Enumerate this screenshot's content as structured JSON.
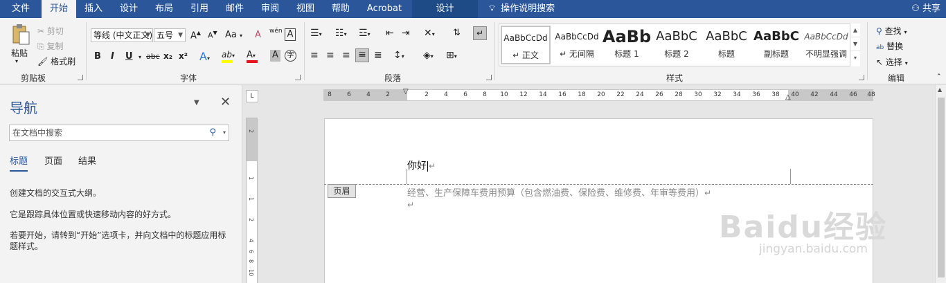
{
  "tabs": [
    "文件",
    "开始",
    "插入",
    "设计",
    "布局",
    "引用",
    "邮件",
    "审阅",
    "视图",
    "帮助",
    "Acrobat",
    "设计"
  ],
  "active_tab": "开始",
  "tell_me": "操作说明搜索",
  "share": "共享",
  "colors": {
    "brand": "#2b579a",
    "ribbon_bg": "#f3f3f3",
    "font_color_bar": "#e8141c",
    "highlight_bar": "#ffff00"
  },
  "ribbon": {
    "clipboard": {
      "paste": "粘贴",
      "cut": "剪切",
      "copy": "复制",
      "format_painter": "格式刷",
      "label": "剪贴板"
    },
    "font": {
      "font_name": "等线 (中文正文)",
      "font_size": "五号",
      "grow": "A",
      "shrink": "A",
      "case": "Aa",
      "clear": "A",
      "phonetic": "wén",
      "border_char": "A",
      "bold": "B",
      "italic": "I",
      "underline": "U",
      "strike": "abc",
      "subscript": "x₂",
      "superscript": "x²",
      "effects": "A",
      "highlight": "ab",
      "font_color": "A",
      "shading": "A",
      "enclose": "字",
      "label": "字体"
    },
    "paragraph": {
      "label": "段落"
    },
    "styles": {
      "items": [
        {
          "sample": "AaBbCcDd",
          "name": "↵ 正文"
        },
        {
          "sample": "AaBbCcDd",
          "name": "↵ 无间隔"
        },
        {
          "sample": "AaBb",
          "name": "标题 1"
        },
        {
          "sample": "AaBbC",
          "name": "标题 2"
        },
        {
          "sample": "AaBbC",
          "name": "标题"
        },
        {
          "sample": "AaBbC",
          "name": "副标题"
        },
        {
          "sample": "AaBbCcDd",
          "name": "不明显强调"
        }
      ],
      "label": "样式"
    },
    "editing": {
      "find": "查找",
      "replace": "替换",
      "select": "选择",
      "label": "编辑"
    }
  },
  "nav": {
    "title": "导航",
    "search_placeholder": "在文档中搜索",
    "tabs": [
      "标题",
      "页面",
      "结果"
    ],
    "hint1": "创建文档的交互式大纲。",
    "hint2": "它是跟踪具体位置或快速移动内容的好方式。",
    "hint3": "若要开始，请转到“开始”选项卡，并向文档中的标题应用标题样式。"
  },
  "ruler": {
    "marks": [
      "8",
      "6",
      "4",
      "2",
      "2",
      "4",
      "6",
      "8",
      "10",
      "12",
      "14",
      "16",
      "18",
      "20",
      "22",
      "24",
      "26",
      "28",
      "30",
      "32",
      "34",
      "36",
      "38",
      "40",
      "42",
      "44",
      "46",
      "48"
    ],
    "vmarks": [
      "2",
      "1",
      "1",
      "2",
      "4",
      "6",
      "8",
      "10"
    ],
    "corner": "L"
  },
  "document": {
    "body_text": "你好",
    "header_tag": "页眉",
    "header_text": "经营、生产保障车费用预算（包含燃油费、保险费、维修费、年审等费用）",
    "para_mark": "↵"
  },
  "watermark": {
    "main": "Baidu经验",
    "sub": "jingyan.baidu.com"
  }
}
